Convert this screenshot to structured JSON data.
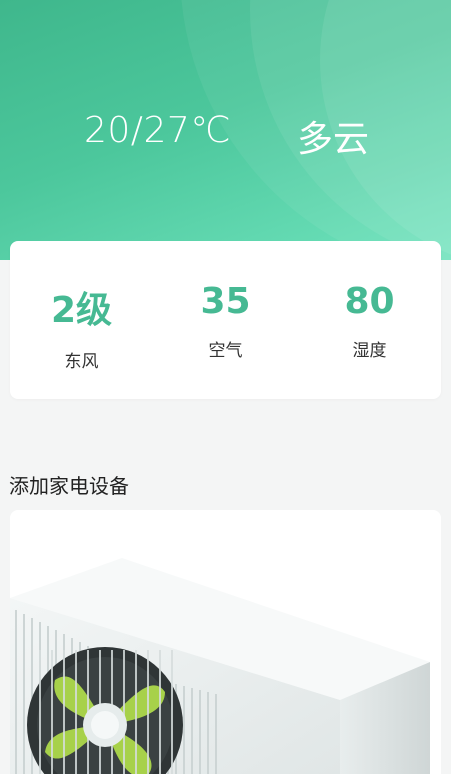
{
  "weather": {
    "temperature": "20/27℃",
    "condition": "多云"
  },
  "stats": [
    {
      "value": "2级",
      "label": "东风"
    },
    {
      "value": "35",
      "label": "空气"
    },
    {
      "value": "80",
      "label": "湿度"
    }
  ],
  "section": {
    "title": "添加家电设备"
  },
  "colors": {
    "header_start": "#3fb78c",
    "header_end": "#6fe3bd",
    "stat_value": "#46b993",
    "fan_blade": "#a7d14a"
  }
}
